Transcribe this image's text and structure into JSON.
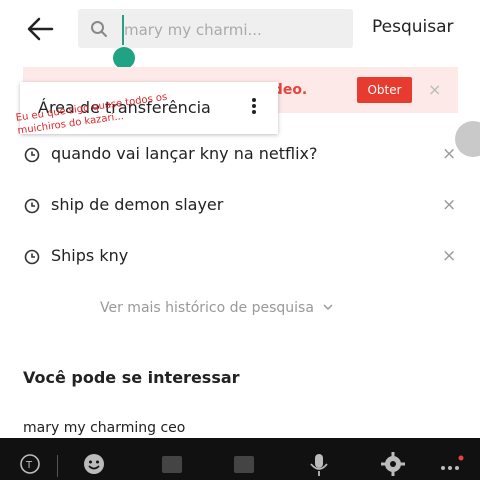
{
  "header": {
    "search_placeholder": "mary my charmi...",
    "search_button": "Pesquisar"
  },
  "banner": {
    "text": "ideo.",
    "button": "Obter",
    "close": "×"
  },
  "clipboard": {
    "title": "Área de transferência"
  },
  "note": {
    "text": "Eu eu que sigo quase todos os muichiros do kazari..."
  },
  "history": [
    {
      "text": "quando vai lançar kny na netflix?",
      "remove": "×"
    },
    {
      "text": "ship de demon slayer",
      "remove": "×"
    },
    {
      "text": "Ships kny",
      "remove": "×"
    }
  ],
  "more_history": "Ver mais histórico de pesquisa",
  "suggestions": {
    "title": "Você pode se interessar",
    "items": [
      "mary my charming ceo"
    ]
  },
  "colors": {
    "accent_red": "#e83b30",
    "caret_green": "#1fa383",
    "banner_bg": "#fde9e8"
  },
  "icons": [
    "back-arrow-icon",
    "search-icon",
    "clock-icon",
    "chevron-down-icon",
    "more-vertical-icon",
    "translate-icon",
    "emoji-icon",
    "sticker-icon",
    "gif-icon",
    "mic-icon",
    "settings-icon",
    "more-horizontal-icon"
  ]
}
